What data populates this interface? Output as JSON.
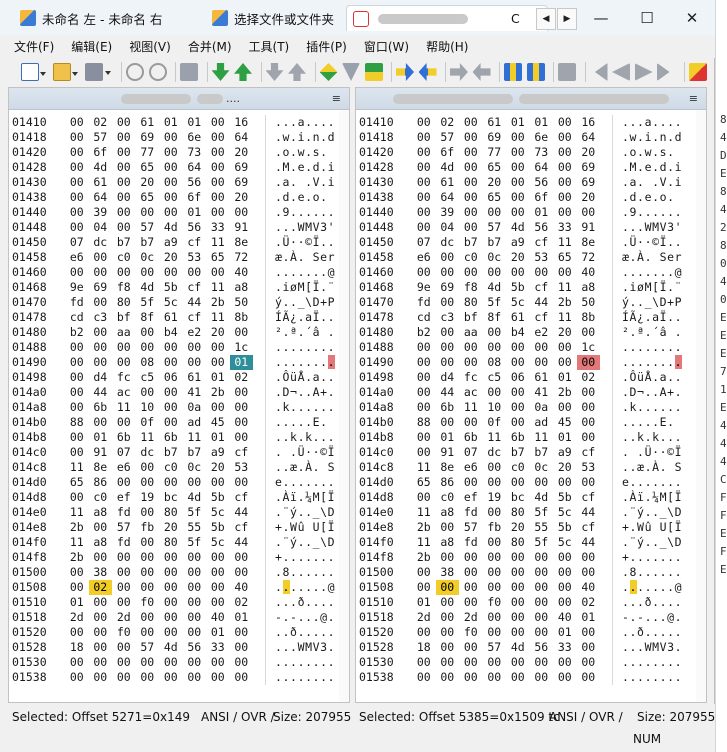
{
  "window": {
    "tabs": [
      {
        "label": "未命名 左 - 未命名 右"
      },
      {
        "label": "选择文件或文件夹"
      },
      {
        "label": "C"
      }
    ],
    "controls": {
      "minimize": "—",
      "maximize": "☐",
      "close": "✕"
    },
    "tab_nav": {
      "prev": "◀",
      "next": "▶"
    }
  },
  "menu": [
    {
      "label": "文件(F)"
    },
    {
      "label": "编辑(E)"
    },
    {
      "label": "视图(V)"
    },
    {
      "label": "合并(M)"
    },
    {
      "label": "工具(T)"
    },
    {
      "label": "插件(P)"
    },
    {
      "label": "窗口(W)"
    },
    {
      "label": "帮助(H)"
    }
  ],
  "panes": {
    "left": {
      "header_suffix": "....",
      "menu_icon": "≡"
    },
    "right": {
      "header_suffix": "",
      "menu_icon": "≡"
    }
  },
  "hex_rows": [
    {
      "off": "01410",
      "b": [
        "00",
        "02",
        "00",
        "61",
        "01",
        "01",
        "00",
        "16"
      ],
      "a": "...a...."
    },
    {
      "off": "01418",
      "b": [
        "00",
        "57",
        "00",
        "69",
        "00",
        "6e",
        "00",
        "64"
      ],
      "a": ".w.i.n.d"
    },
    {
      "off": "01420",
      "b": [
        "00",
        "6f",
        "00",
        "77",
        "00",
        "73",
        "00",
        "20"
      ],
      "a": ".o.w.s. "
    },
    {
      "off": "01428",
      "b": [
        "00",
        "4d",
        "00",
        "65",
        "00",
        "64",
        "00",
        "69"
      ],
      "a": ".M.e.d.i"
    },
    {
      "off": "01430",
      "b": [
        "00",
        "61",
        "00",
        "20",
        "00",
        "56",
        "00",
        "69"
      ],
      "a": ".a. .V.i"
    },
    {
      "off": "01438",
      "b": [
        "00",
        "64",
        "00",
        "65",
        "00",
        "6f",
        "00",
        "20"
      ],
      "a": ".d.e.o. "
    },
    {
      "off": "01440",
      "b": [
        "00",
        "39",
        "00",
        "00",
        "00",
        "01",
        "00",
        "00"
      ],
      "a": ".9......"
    },
    {
      "off": "01448",
      "b": [
        "00",
        "04",
        "00",
        "57",
        "4d",
        "56",
        "33",
        "91"
      ],
      "a": "...WMV3'"
    },
    {
      "off": "01450",
      "b": [
        "07",
        "dc",
        "b7",
        "b7",
        "a9",
        "cf",
        "11",
        "8e"
      ],
      "a": ".Ü··©Ï.."
    },
    {
      "off": "01458",
      "b": [
        "e6",
        "00",
        "c0",
        "0c",
        "20",
        "53",
        "65",
        "72"
      ],
      "a": "æ.À. Ser"
    },
    {
      "off": "01460",
      "b": [
        "00",
        "00",
        "00",
        "00",
        "00",
        "00",
        "00",
        "40"
      ],
      "a": ".......@"
    },
    {
      "off": "01468",
      "b": [
        "9e",
        "69",
        "f8",
        "4d",
        "5b",
        "cf",
        "11",
        "a8"
      ],
      "a": ".iøM[Ï.¨"
    },
    {
      "off": "01470",
      "b": [
        "fd",
        "00",
        "80",
        "5f",
        "5c",
        "44",
        "2b",
        "50"
      ],
      "a": "ý.._\\D+P"
    },
    {
      "off": "01478",
      "b": [
        "cd",
        "c3",
        "bf",
        "8f",
        "61",
        "cf",
        "11",
        "8b"
      ],
      "a": "ÍÃ¿.aÏ.."
    },
    {
      "off": "01480",
      "b": [
        "b2",
        "00",
        "aa",
        "00",
        "b4",
        "e2",
        "20",
        "00"
      ],
      "a": "².ª.´â ."
    },
    {
      "off": "01488",
      "b": [
        "00",
        "00",
        "00",
        "00",
        "00",
        "00",
        "00",
        "1c"
      ],
      "a": "........"
    },
    {
      "off": "01490",
      "b": [
        "00",
        "00",
        "00",
        "08",
        "00",
        "00",
        "00",
        "01"
      ],
      "a": "........",
      "r": {
        "b7": "00"
      }
    },
    {
      "off": "01498",
      "b": [
        "00",
        "d4",
        "fc",
        "c5",
        "06",
        "61",
        "01",
        "02"
      ],
      "a": ".ÔüÅ.a.."
    },
    {
      "off": "014a0",
      "b": [
        "00",
        "44",
        "ac",
        "00",
        "00",
        "41",
        "2b",
        "00"
      ],
      "a": ".D¬..A+."
    },
    {
      "off": "014a8",
      "b": [
        "00",
        "6b",
        "11",
        "10",
        "00",
        "0a",
        "00",
        "00"
      ],
      "a": ".k......"
    },
    {
      "off": "014b0",
      "b": [
        "88",
        "00",
        "00",
        "0f",
        "00",
        "ad",
        "45",
        "00"
      ],
      "a": ".....­E."
    },
    {
      "off": "014b8",
      "b": [
        "00",
        "01",
        "6b",
        "11",
        "6b",
        "11",
        "01",
        "00"
      ],
      "a": "..k.k..."
    },
    {
      "off": "014c0",
      "b": [
        "00",
        "91",
        "07",
        "dc",
        "b7",
        "b7",
        "a9",
        "cf"
      ],
      "a": ". .Ü··©Ï"
    },
    {
      "off": "014c8",
      "b": [
        "11",
        "8e",
        "e6",
        "00",
        "c0",
        "0c",
        "20",
        "53"
      ],
      "a": "..æ.À. S"
    },
    {
      "off": "014d0",
      "b": [
        "65",
        "86",
        "00",
        "00",
        "00",
        "00",
        "00",
        "00"
      ],
      "a": "e......."
    },
    {
      "off": "014d8",
      "b": [
        "00",
        "c0",
        "ef",
        "19",
        "bc",
        "4d",
        "5b",
        "cf"
      ],
      "a": ".Àï.¼M[Ï"
    },
    {
      "off": "014e0",
      "b": [
        "11",
        "a8",
        "fd",
        "00",
        "80",
        "5f",
        "5c",
        "44"
      ],
      "a": ".¨ý.._\\D"
    },
    {
      "off": "014e8",
      "b": [
        "2b",
        "00",
        "57",
        "fb",
        "20",
        "55",
        "5b",
        "cf"
      ],
      "a": "+.Wû U[Ï"
    },
    {
      "off": "014f0",
      "b": [
        "11",
        "a8",
        "fd",
        "00",
        "80",
        "5f",
        "5c",
        "44"
      ],
      "a": ".¨ý.._\\D"
    },
    {
      "off": "014f8",
      "b": [
        "2b",
        "00",
        "00",
        "00",
        "00",
        "00",
        "00",
        "00"
      ],
      "a": "+......."
    },
    {
      "off": "01500",
      "b": [
        "00",
        "38",
        "00",
        "00",
        "00",
        "00",
        "00",
        "00"
      ],
      "a": ".8......"
    },
    {
      "off": "01508",
      "b": [
        "00",
        "02",
        "00",
        "00",
        "00",
        "00",
        "00",
        "40"
      ],
      "a": ".......@",
      "r": {
        "b1": "00"
      }
    },
    {
      "off": "01510",
      "b": [
        "01",
        "00",
        "00",
        "f0",
        "00",
        "00",
        "00",
        "02"
      ],
      "a": "...ð...."
    },
    {
      "off": "01518",
      "b": [
        "2d",
        "00",
        "2d",
        "00",
        "00",
        "00",
        "40",
        "01"
      ],
      "a": "-.-...@."
    },
    {
      "off": "01520",
      "b": [
        "00",
        "00",
        "f0",
        "00",
        "00",
        "00",
        "01",
        "00"
      ],
      "a": "..ð....."
    },
    {
      "off": "01528",
      "b": [
        "18",
        "00",
        "00",
        "57",
        "4d",
        "56",
        "33",
        "00"
      ],
      "a": "...WMV3."
    },
    {
      "off": "01530",
      "b": [
        "00",
        "00",
        "00",
        "00",
        "00",
        "00",
        "00",
        "00"
      ],
      "a": "........"
    },
    {
      "off": "01538",
      "b": [
        "00",
        "00",
        "00",
        "00",
        "00",
        "00",
        "00",
        "00"
      ],
      "a": "........"
    }
  ],
  "status": {
    "left_selected": "Selected: Offset 5271=0x149",
    "left_mode": "ANSI / OVR /",
    "left_size": "Size: 207955",
    "right_selected": "Selected: Offset 5385=0x1509 tc",
    "right_mode": "ANSI / OVR /",
    "right_size": "Size: 207955",
    "num": "NUM"
  },
  "side_strip": [
    "8",
    "4",
    "D",
    "E",
    "8",
    "4",
    "2",
    "8",
    "0",
    "4",
    "0",
    "E",
    "E",
    "E",
    "7",
    "1",
    "E",
    "4",
    "4",
    "4",
    "C",
    "F",
    "F",
    "E",
    "F",
    "E"
  ],
  "highlight_colors": {
    "teal": "#2e8f9a",
    "red": "#e37878",
    "yellow": "#f2cc27"
  }
}
